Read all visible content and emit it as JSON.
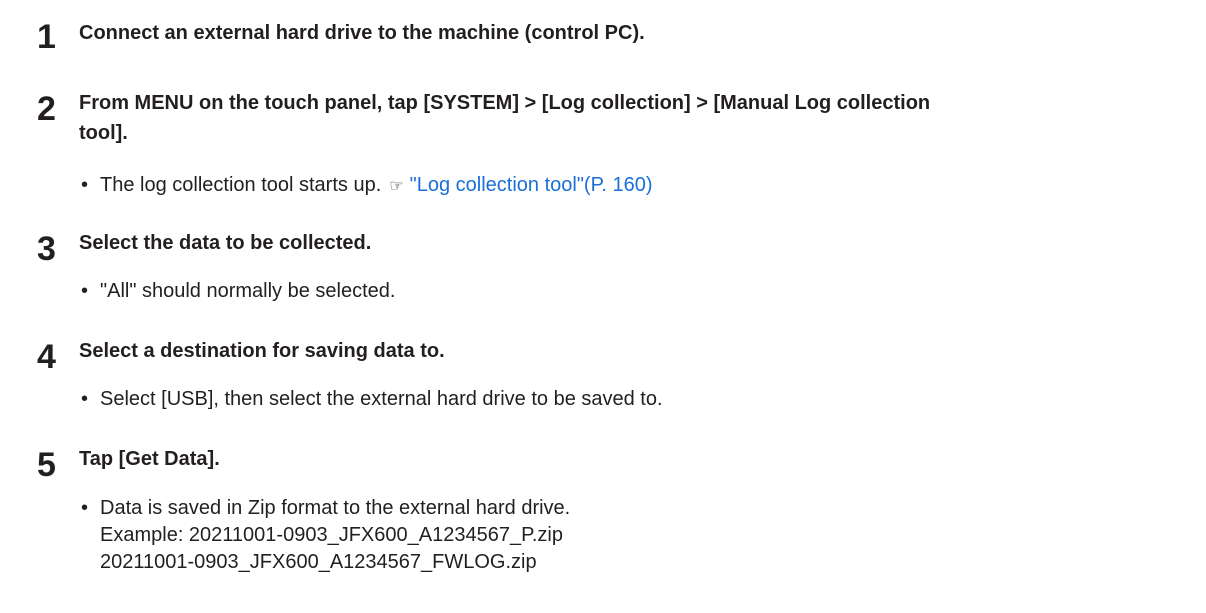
{
  "steps": [
    {
      "number": "1",
      "heading": "Connect an external hard drive to the machine (control PC)."
    },
    {
      "number": "2",
      "heading_line1": "From MENU on the touch panel, tap [SYSTEM] > [Log collection] > [Manual Log collection",
      "heading_line2": "tool].",
      "bullet_text": "The log collection tool starts up.",
      "ref_icon": "reference-icon",
      "link_text": "\"Log collection tool\"(P. 160)"
    },
    {
      "number": "3",
      "heading": "Select the data to be collected.",
      "bullet_text": "\"All\" should normally be selected."
    },
    {
      "number": "4",
      "heading": "Select a destination for saving data to.",
      "bullet_text": "Select [USB], then select the external hard drive to be saved to."
    },
    {
      "number": "5",
      "heading": "Tap [Get Data].",
      "bullet_line1": "Data is saved in Zip format to the external hard drive.",
      "bullet_line2": "Example: 20211001-0903_JFX600_A1234567_P.zip",
      "bullet_line3": "20211001-0903_JFX600_A1234567_FWLOG.zip"
    }
  ],
  "bullet_char": "•",
  "link_color": "#1a6fd6"
}
